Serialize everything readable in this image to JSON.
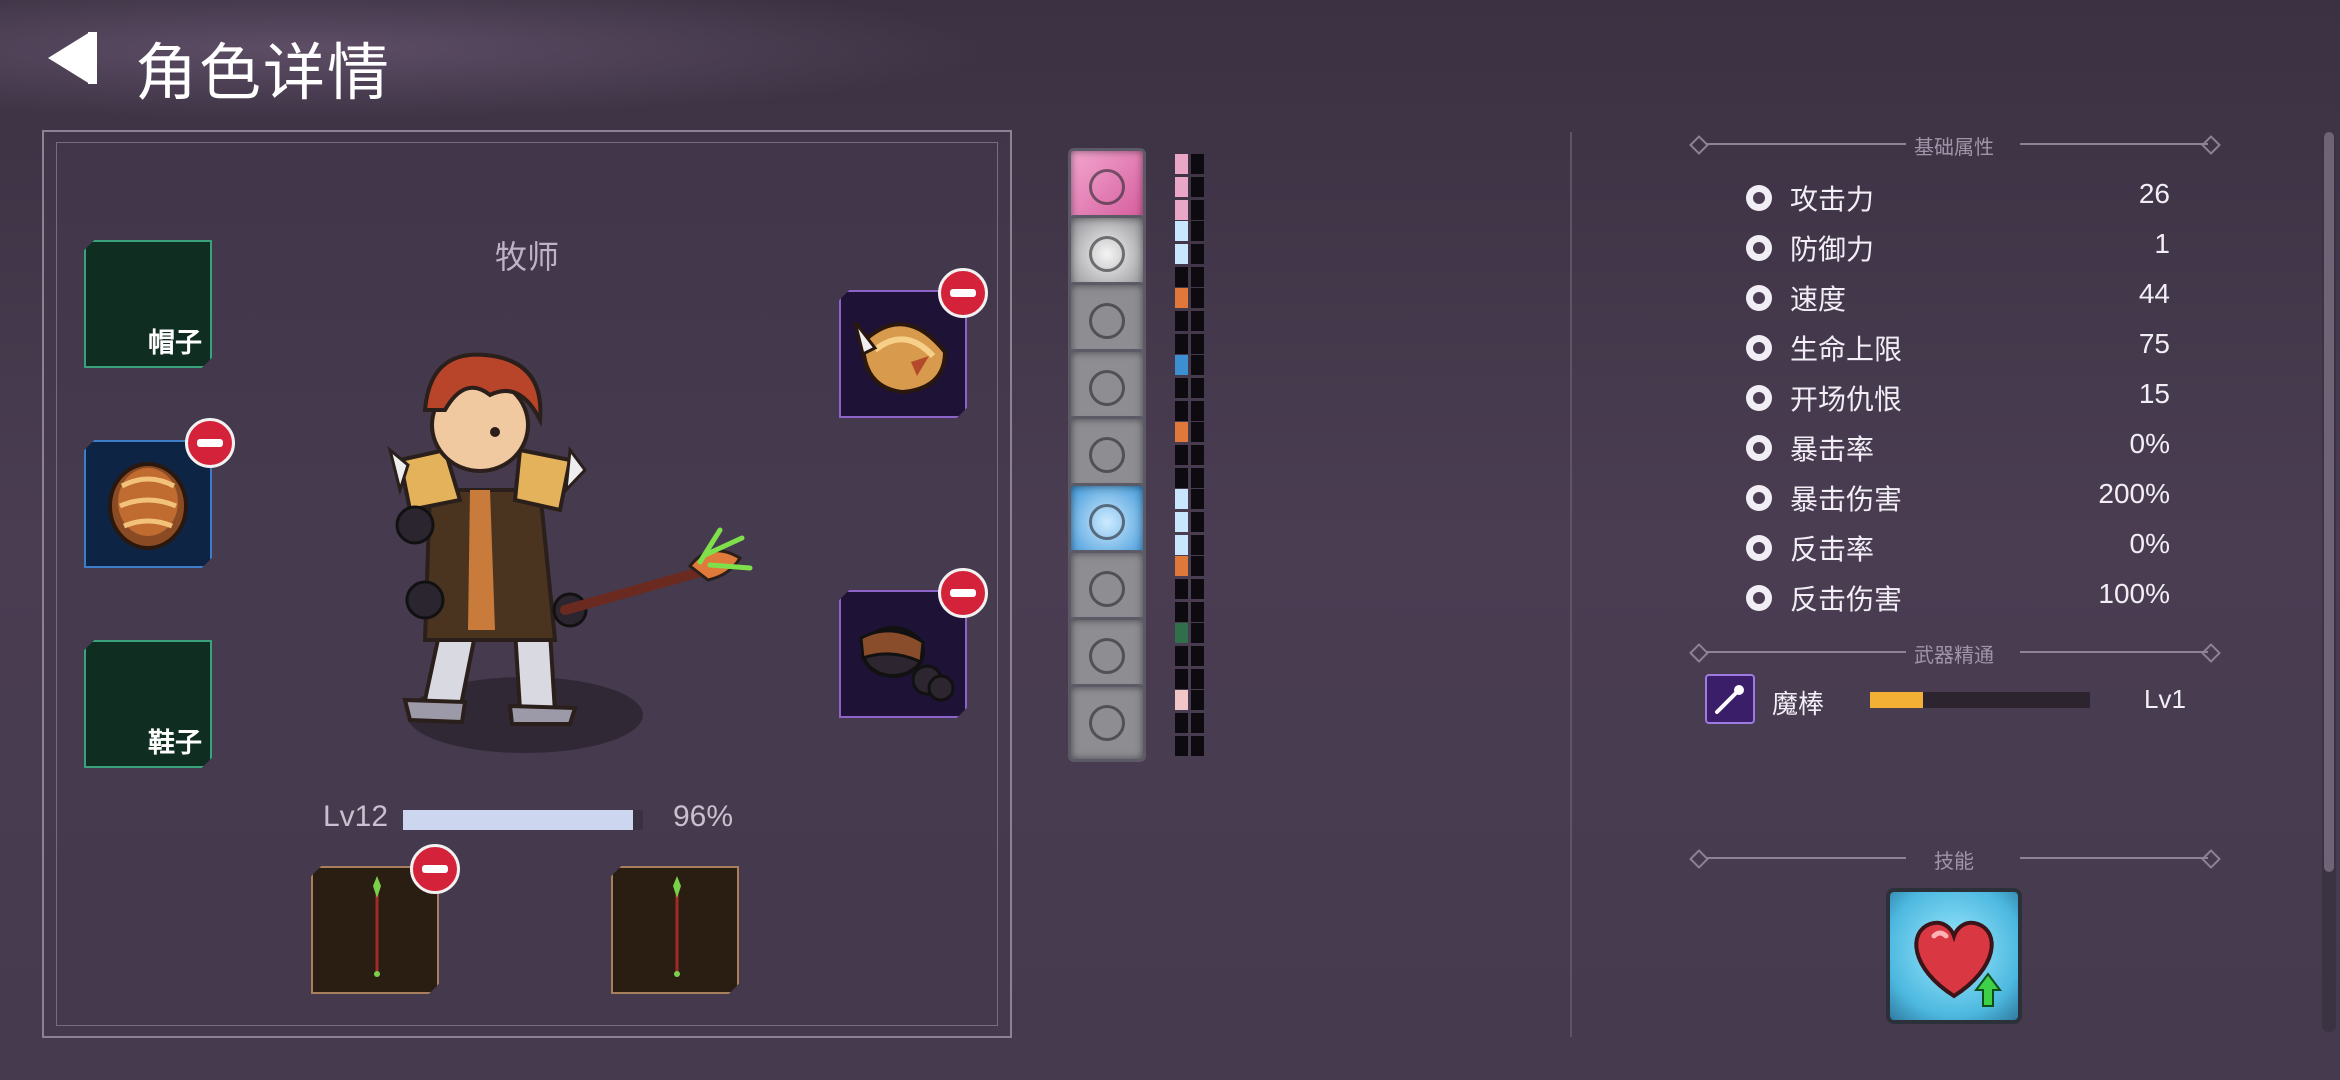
{
  "header": {
    "title": "角色详情"
  },
  "character": {
    "class_name": "牧师",
    "level": "Lv12",
    "xp_fraction": 0.96,
    "xp_percent_text": "96%"
  },
  "equipment": {
    "hat": {
      "label": "帽子",
      "state": "empty"
    },
    "armor": {
      "label": "",
      "state": "equipped"
    },
    "shoes": {
      "label": "鞋子",
      "state": "empty"
    },
    "right_top": {
      "state": "equipped"
    },
    "right_bottom": {
      "state": "equipped"
    },
    "weapon_left": {
      "state": "equipped"
    },
    "weapon_right": {
      "state": "equipped"
    }
  },
  "abilities": [
    {
      "icon": "boot-icon",
      "color": "#e9a6c7",
      "pips": [
        1,
        1,
        1
      ]
    },
    {
      "icon": "body-target-icon",
      "color": "#c9e6ff",
      "pips": [
        1,
        1,
        0
      ]
    },
    {
      "icon": "rain-figure-icon",
      "color": "#e0783a",
      "pips": [
        1,
        0,
        0
      ]
    },
    {
      "icon": "fist-punch-icon",
      "color": "#3c8fd1",
      "pips": [
        1,
        0,
        0
      ]
    },
    {
      "icon": "hand-grab-icon",
      "color": "#e0783a",
      "pips": [
        1,
        0,
        0
      ]
    },
    {
      "icon": "winged-shield-icon",
      "color": "#c9e6ff",
      "pips": [
        1,
        1,
        1
      ]
    },
    {
      "icon": "skull-icon",
      "color": "#e0783a",
      "pips": [
        1,
        0,
        0
      ]
    },
    {
      "icon": "gears-icon",
      "color": "#2f6f4a",
      "pips": [
        1,
        0,
        0
      ]
    },
    {
      "icon": "crossed-swords-icon",
      "color": "#f1c6c6",
      "pips": [
        1,
        0,
        0
      ]
    }
  ],
  "stats": {
    "section_title": "基础属性",
    "rows": [
      {
        "icon": "sword-icon",
        "name": "攻击力",
        "value": "26"
      },
      {
        "icon": "shield-icon",
        "name": "防御力",
        "value": "1"
      },
      {
        "icon": "boot-speed-icon",
        "name": "速度",
        "value": "44"
      },
      {
        "icon": "heart-icon",
        "name": "生命上限",
        "value": "75"
      },
      {
        "icon": "skull-icon",
        "name": "开场仇恨",
        "value": "15"
      },
      {
        "icon": "crit-burst-icon",
        "name": "暴击率",
        "value": "0%"
      },
      {
        "icon": "crossed-blades-icon",
        "name": "暴击伤害",
        "value": "200%"
      },
      {
        "icon": "counter-icon",
        "name": "反击率",
        "value": "0%"
      },
      {
        "icon": "counter-damage-icon",
        "name": "反击伤害",
        "value": "100%"
      }
    ]
  },
  "weapon_mastery": {
    "section_title": "武器精通",
    "weapon_name": "魔棒",
    "progress_fraction": 0.24,
    "level": "Lv1"
  },
  "skills": {
    "section_title": "技能",
    "items": [
      {
        "icon": "heart-upgrade-icon"
      }
    ]
  }
}
